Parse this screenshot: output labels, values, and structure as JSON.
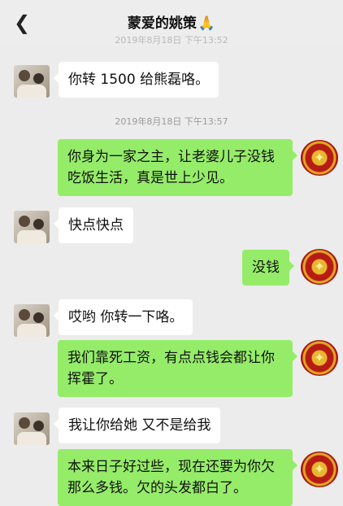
{
  "header": {
    "title": "蒙爱的姚策",
    "title_emoji": "🙏",
    "back_icon": "chevron-left-icon"
  },
  "timestamps": [
    "2019年8月18日 下午13:52",
    "2019年8月18日 下午13:57"
  ],
  "messages": [
    {
      "side": "left",
      "lines": [
        "你转 1500 给熊磊咯。"
      ]
    },
    {
      "side": "right",
      "lines": [
        "你身为一家之主，让老婆儿子没钱",
        "吃饭生活，真是世上少见。"
      ]
    },
    {
      "side": "left",
      "lines": [
        "快点快点"
      ]
    },
    {
      "side": "right",
      "lines": [
        "没钱"
      ]
    },
    {
      "side": "left",
      "lines": [
        "哎哟 你转一下咯。"
      ]
    },
    {
      "side": "right",
      "lines": [
        "我们靠死工资，有点点钱会都让你",
        "挥霍了。"
      ]
    },
    {
      "side": "left",
      "lines": [
        "我让你给她 又不是给我"
      ]
    },
    {
      "side": "right",
      "lines": [
        "本来日子好过些，现在还要为你欠",
        "那么多钱。欠的头发都白了。"
      ]
    }
  ],
  "colors": {
    "chat_bg": "#ececec",
    "bubble_left": "#ffffff",
    "bubble_right": "#95ec69",
    "timestamp": "#9a9a9a"
  }
}
